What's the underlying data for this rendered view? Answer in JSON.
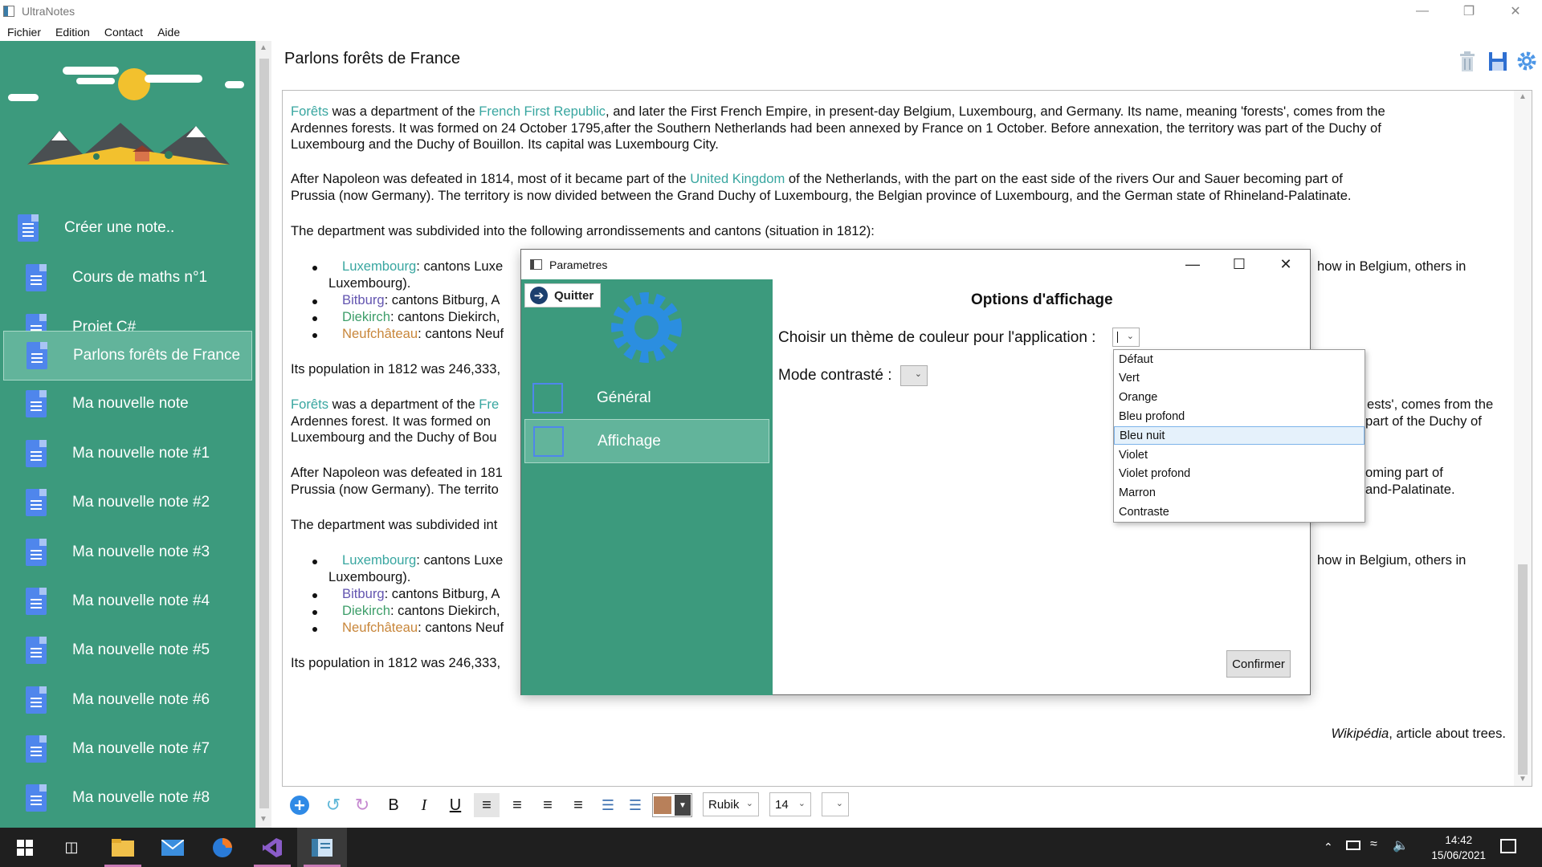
{
  "window": {
    "title": "UltraNotes"
  },
  "menu": [
    "Fichier",
    "Edition",
    "Contact",
    "Aide"
  ],
  "sidebar": {
    "create_label": "Créer une note..",
    "notes": [
      "Cours de maths n°1",
      "Projet C#",
      "Parlons forêts de France",
      "Ma nouvelle note",
      "Ma nouvelle note #1",
      "Ma nouvelle note #2",
      "Ma nouvelle note #3",
      "Ma nouvelle note #4",
      "Ma nouvelle note #5",
      "Ma nouvelle note #6",
      "Ma nouvelle note #7",
      "Ma nouvelle note #8"
    ],
    "selected_index": 2
  },
  "header": {
    "doc_title": "Parlons forêts de France",
    "icons": [
      "trash-icon",
      "save-icon",
      "settings-gear-icon"
    ]
  },
  "document": {
    "p1": {
      "link1": "Forêts",
      "t1": " was a department of the ",
      "link2": "French First Republic",
      "t2": ", and later the First French Empire, in present-day Belgium, Luxembourg, and Germany. Its name, meaning 'forests', comes from the",
      "l2": "Ardennes forests. It was formed on 24 October 1795,after the Southern Netherlands had been annexed by France on 1 October. Before annexation, the territory was part of the Duchy of",
      "l3": "Luxembourg and the Duchy of Bouillon. Its capital was Luxembourg City."
    },
    "p2": {
      "t1": "After Napoleon was defeated in 1814, most of it became part of the ",
      "link": "United Kingdom",
      "t2": " of the Netherlands, with the part on the east side of the rivers Our and Sauer becoming part of",
      "l2": "Prussia (now Germany). The territory is now divided between the Grand Duchy of Luxembourg, the Belgian province of Luxembourg, and the German state of Rhineland-Palatinate."
    },
    "p3": "The department was subdivided into the following arrondissements and cantons (situation in 1812):",
    "bullets": [
      {
        "link": "Luxembourg",
        "text": ": cantons Luxe",
        "tail": "how in Belgium, others in",
        "cont": "Luxembourg)."
      },
      {
        "link": "Bitburg",
        "text": ": cantons Bitburg, A"
      },
      {
        "link": "Diekirch",
        "text": ": cantons Diekirch, "
      },
      {
        "link": "Neufchâteau",
        "text": ": cantons Neuf"
      }
    ],
    "p4": "Its population in 1812 was 246,333,",
    "p5": {
      "link1": "Forêts",
      "t1": " was a department of the ",
      "link2": "Fre",
      "tail1": "ests', comes from the",
      "l2": "Ardennes forest. It was formed on",
      "tail2": "part of the Duchy of",
      "l3": "Luxembourg and the Duchy of Bou"
    },
    "p6": {
      "t1": "After Napoleon was defeated in 181",
      "tail1": "oming part of",
      "l2": "Prussia (now Germany). The territo",
      "tail2": "and-Palatinate."
    },
    "p7": "The department was subdivided int",
    "p8": "Its population in 1812 was 246,333,",
    "citation": {
      "italic": "Wikipédia",
      "rest": ", article about trees."
    }
  },
  "toolbar": {
    "bold": "B",
    "italic": "I",
    "underline": "U",
    "font": "Rubik",
    "size": "14",
    "color": "#b8805a"
  },
  "dialog": {
    "title": "Parametres",
    "quit_label": "Quitter",
    "nav": [
      "Général",
      "Affichage"
    ],
    "nav_selected_index": 1,
    "heading": "Options d'affichage",
    "theme_label": "Choisir un thème de couleur pour l'application :",
    "contrast_label": "Mode contrasté :",
    "theme_options": [
      "Défaut",
      "Vert",
      "Orange",
      "Bleu profond",
      "Bleu nuit",
      "Violet",
      "Violet profond",
      "Marron",
      "Contraste"
    ],
    "theme_highlighted_index": 4,
    "confirm_label": "Confirmer"
  },
  "taskbar": {
    "time": "14:42",
    "date": "15/06/2021"
  },
  "colors": {
    "sidebar_green": "#3c9a7d",
    "selected_green": "#62b49b",
    "doc_icon_blue": "#4f86ec"
  }
}
